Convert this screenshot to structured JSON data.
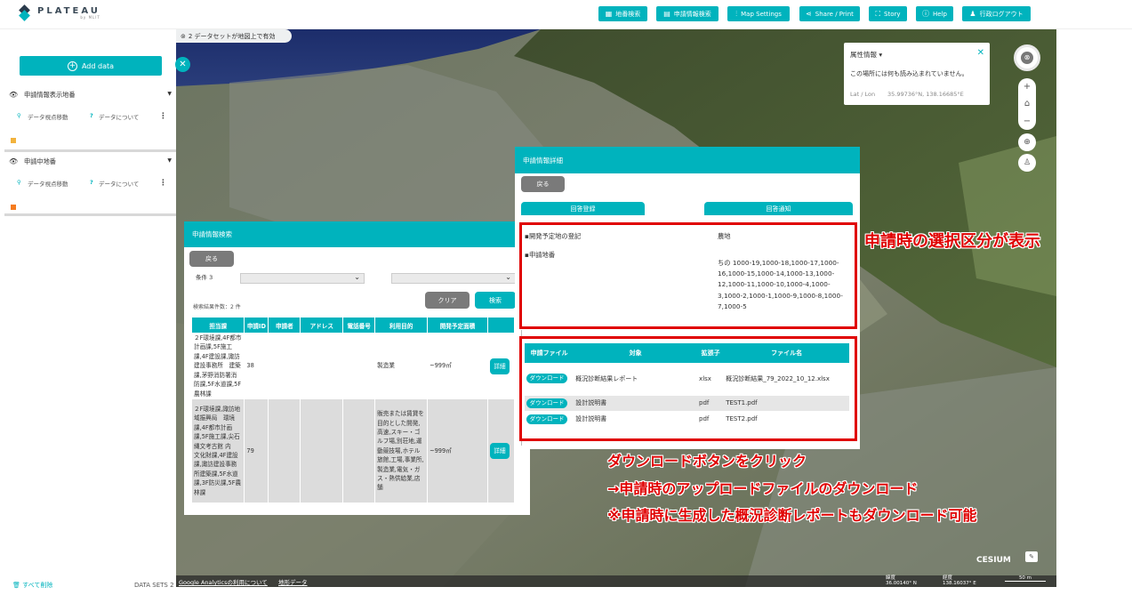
{
  "app": {
    "logo": "PLATEAU",
    "logo_sub": "by MLIT"
  },
  "toolbar": [
    {
      "icon": "map-search-icon",
      "label": "地番検索"
    },
    {
      "icon": "document-search-icon",
      "label": "申請情報検索"
    },
    {
      "icon": "sliders-icon",
      "label": "Map Settings"
    },
    {
      "icon": "share-icon",
      "label": "Share / Print"
    },
    {
      "icon": "story-icon",
      "label": "Story"
    },
    {
      "icon": "help-icon",
      "label": "Help"
    },
    {
      "icon": "user-icon",
      "label": "行政ログアウト"
    }
  ],
  "sidebar": {
    "add_data": "Add data",
    "layers": [
      {
        "title": "申請情報表示地番",
        "move": "データ視点移動",
        "about": "データについて",
        "legend_color": "#f2b33d"
      },
      {
        "title": "申請中地番",
        "move": "データ視点移動",
        "about": "データについて",
        "legend_color": "#f57c1f"
      }
    ],
    "remove_all": "すべて削除",
    "datasets": "DATA SETS 2"
  },
  "map": {
    "datasets_badge": "2 データセットが地図上で有効"
  },
  "attribute_panel": {
    "title": "属性情報",
    "message": "この場所には何も読み込まれていません。",
    "latlon_label": "Lat / Lon",
    "latlon_value": "35.99736°N, 138.16685°E"
  },
  "search_panel": {
    "title": "申請情報検索",
    "back": "戻る",
    "condition": "条件 3",
    "clear": "クリア",
    "search": "検索",
    "result_count": "検索結果件数：2 件",
    "columns": [
      "担当課",
      "申請ID",
      "申請者",
      "アドレス",
      "電話番号",
      "利用目的",
      "開発予定面積"
    ],
    "rows": [
      {
        "dept": "２F環境課,4F都市計画課,5F施工課,4F建設課,諏訪建設事務所　建築課,茅野消防署消防課,5F水道課,5F農林課",
        "id": "38",
        "applicant": "",
        "address": "",
        "phone": "",
        "purpose": "製造業",
        "area": "~999㎡",
        "detail": "詳細"
      },
      {
        "dept": "２F環境課,諏訪地域振興局　環境課,4F都市計画課,5F施工課,尖石縄文考古館 内　文化財課,4F建設課,諏訪建設事務所建築課,5F水道課,3F防災課,5F農林課",
        "id": "79",
        "applicant": "",
        "address": "",
        "phone": "",
        "purpose": "販売または賃貸を目的とした開発,高速,スキー・ゴルフ場,別荘地,運動競技場,ホテル旅館,工場,事業所,製造業,電気・ガス・熱供給業,店舗",
        "area": "~999㎡",
        "detail": "詳細"
      }
    ]
  },
  "detail_panel": {
    "title": "申請情報詳細",
    "back": "戻る",
    "reply_register": "回答登録",
    "reply_notice": "回答通知",
    "items": [
      {
        "label": "開発予定地の登記",
        "value": "農地"
      },
      {
        "label": "申請地番",
        "value": "ちの 1000-19,1000-18,1000-17,1000-16,1000-15,1000-14,1000-13,1000-12,1000-11,1000-10,1000-4,1000-3,1000-2,1000-1,1000-9,1000-8,1000-7,1000-5"
      }
    ],
    "file_columns": [
      "申請ファイル",
      "対象",
      "拡張子",
      "ファイル名"
    ],
    "files": [
      {
        "button": "ダウンロード",
        "target": "概況診断結果レポート",
        "ext": "xlsx",
        "name": "概況診断結果_79_2022_10_12.xlsx"
      },
      {
        "button": "ダウンロード",
        "target": "設計説明書",
        "ext": "pdf",
        "name": "TEST1.pdf"
      },
      {
        "button": "ダウンロード",
        "target": "設計説明書",
        "ext": "pdf",
        "name": "TEST2.pdf"
      }
    ]
  },
  "annotations": {
    "note1": "申請時の選択区分が表示",
    "note2_line1": "ダウンロードボタンをクリック",
    "note2_line2": "→申請時のアップロードファイルのダウンロード",
    "note2_line3": "※申請時に生成した概況診断レポートもダウンロード可能"
  },
  "footer": {
    "ga": "Google Analyticsの利用について",
    "terrain": "地形データ",
    "lat_label": "緯度",
    "lat": "36.00140° N",
    "lon_label": "経度",
    "lon": "138.16037° E",
    "scale": "50 m",
    "cesium": "CESIUM"
  }
}
